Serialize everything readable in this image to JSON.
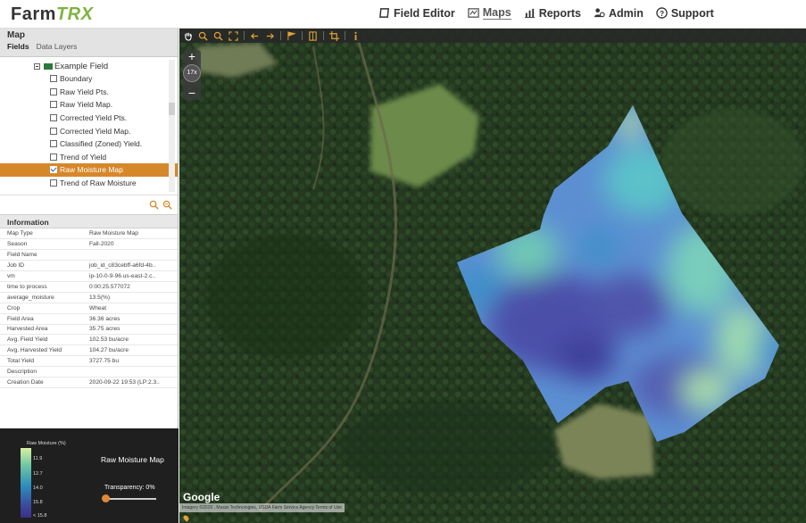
{
  "app": {
    "logo_main": "Farm",
    "logo_accent": "TRX"
  },
  "nav": [
    {
      "label": "Field Editor",
      "icon": "field-editor-icon"
    },
    {
      "label": "Maps",
      "icon": "maps-icon",
      "active": true
    },
    {
      "label": "Reports",
      "icon": "reports-icon"
    },
    {
      "label": "Admin",
      "icon": "admin-icon"
    },
    {
      "label": "Support",
      "icon": "support-icon"
    }
  ],
  "sidebar": {
    "title": "Map",
    "tabs": [
      "Fields",
      "Data Layers"
    ],
    "tree_root": "Example Field",
    "layers": [
      {
        "label": "Boundary",
        "checked": false
      },
      {
        "label": "Raw Yield Pts.",
        "checked": false
      },
      {
        "label": "Raw Yield Map.",
        "checked": false
      },
      {
        "label": "Corrected Yield Pts.",
        "checked": false
      },
      {
        "label": "Corrected Yield Map.",
        "checked": false
      },
      {
        "label": "Classified (Zoned) Yield.",
        "checked": false
      },
      {
        "label": "Trend of Yield",
        "checked": false
      },
      {
        "label": "Raw Moisture Map",
        "checked": true,
        "selected": true
      },
      {
        "label": "Trend of Raw Moisture",
        "checked": false
      }
    ]
  },
  "info": {
    "title": "Information",
    "rows": [
      [
        "Map Type",
        "Raw Moisture Map"
      ],
      [
        "Season",
        "Fall-2020"
      ],
      [
        "Field Name",
        ""
      ],
      [
        "Job ID",
        "job_id_c83cebff-a6fd-4b.."
      ],
      [
        "vm",
        "ip-10-0-9-96.us-east-2.c.."
      ],
      [
        "time to process",
        "0:00:25.577072"
      ],
      [
        "average_moisture",
        "13.5(%)"
      ],
      [
        "Crop",
        "Wheat"
      ],
      [
        "Field Area",
        "36.36 acres"
      ],
      [
        "Harvested Area",
        "35.75 acres"
      ],
      [
        "Avg. Field Yield",
        "102.53 bu/acre"
      ],
      [
        "Avg. Harvested Yield",
        "104.27 bu/acre"
      ],
      [
        "Total Yield",
        "3727.75 bu"
      ],
      [
        "Description",
        ""
      ],
      [
        "Creation Date",
        "2020-09-22 19:53 (LP:2.3.."
      ]
    ]
  },
  "legend": {
    "title": "Raw Moisture (%)",
    "values": [
      "11.9",
      "12.7",
      "14.0",
      "15.8",
      "< 15.8"
    ],
    "map_name": "Raw Moisture Map",
    "transparency_label": "Transparency: 0%",
    "transparency": 0,
    "colors": [
      "#d9f0a3",
      "#6ec6a2",
      "#2b8cbe",
      "#3b4fa0",
      "#3b2f86"
    ]
  },
  "map": {
    "zoom_level": "17x",
    "zoom_in": "+",
    "zoom_out": "−",
    "provider": "Google",
    "attribution": "Imagery ©2020 , Maxar Technologies, USDA Farm Service Agency  Terms of Use"
  }
}
